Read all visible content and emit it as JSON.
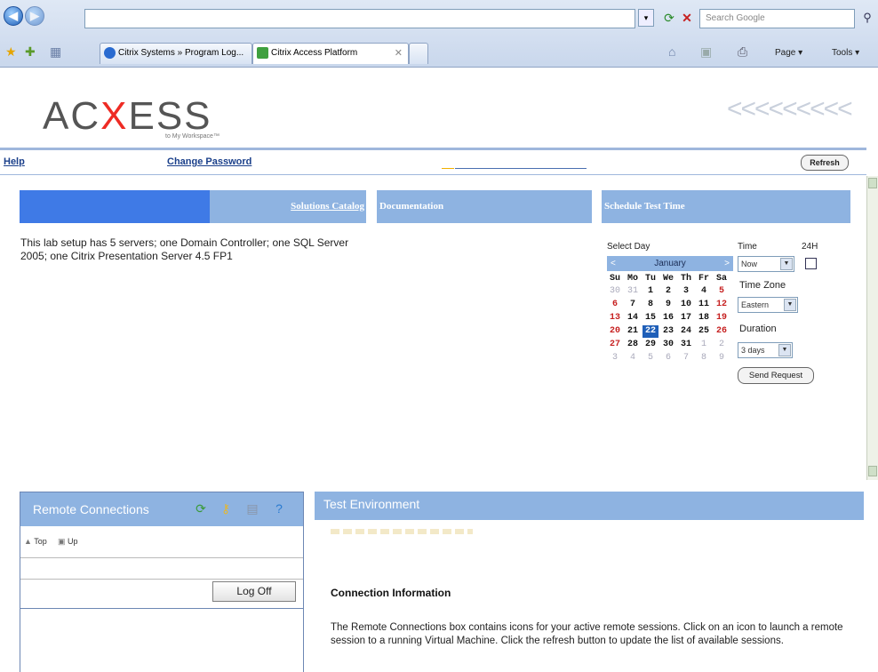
{
  "browser": {
    "address_value": "",
    "search_placeholder": "Search Google",
    "tabs": [
      {
        "label": "Citrix Systems » Program Log..."
      },
      {
        "label": "Citrix Access Platform"
      }
    ],
    "commands": {
      "page": "Page ▾",
      "tools": "Tools ▾"
    }
  },
  "header": {
    "logo_left": "AC",
    "logo_x": "X",
    "logo_right": "ESS",
    "logo_sub": "to My Workspace™",
    "arrows": "<<<<<<<<<"
  },
  "links": {
    "help": "Help",
    "change_password": "Change Password",
    "refresh": "Refresh"
  },
  "columns": {
    "solutions_catalog": "Solutions Catalog",
    "documentation": "Documentation",
    "schedule_test_time": "Schedule Test Time"
  },
  "lab_description": "This lab setup has 5 servers; one Domain Controller; one SQL Server 2005; one Citrix Presentation Server 4.5 FP1",
  "schedule": {
    "select_day_label": "Select Day",
    "time_label": "Time",
    "h24_label": "24H",
    "time_value": "Now",
    "time_zone_label": "Time Zone",
    "time_zone_value": "Eastern",
    "duration_label": "Duration",
    "duration_value": "3 days",
    "send_request": "Send Request",
    "calendar": {
      "month": "January",
      "weekdays": [
        "Su",
        "Mo",
        "Tu",
        "We",
        "Th",
        "Fr",
        "Sa"
      ],
      "weeks": [
        [
          "30",
          "31",
          "1",
          "2",
          "3",
          "4",
          "5"
        ],
        [
          "6",
          "7",
          "8",
          "9",
          "10",
          "11",
          "12"
        ],
        [
          "13",
          "14",
          "15",
          "16",
          "17",
          "18",
          "19"
        ],
        [
          "20",
          "21",
          "22",
          "23",
          "24",
          "25",
          "26"
        ],
        [
          "27",
          "28",
          "29",
          "30",
          "31",
          "1",
          "2"
        ],
        [
          "3",
          "4",
          "5",
          "6",
          "7",
          "8",
          "9"
        ]
      ],
      "selected_day": "22"
    }
  },
  "remote_connections": {
    "title": "Remote Connections",
    "nav_top": "Top",
    "nav_up": "Up",
    "log_off": "Log Off"
  },
  "test_environment": {
    "title": "Test Environment",
    "connection_info_title": "Connection Information",
    "connection_info_text": "The Remote Connections box contains icons for your active remote sessions. Click on an icon to launch a remote session to a running Virtual Machine. Click the refresh button to update the list of available sessions."
  },
  "colors": {
    "accent_blue": "#8eb3e1",
    "bright_blue": "#3f7ae6",
    "logo_red": "#ee2b24",
    "weekend_red": "#c62020"
  }
}
